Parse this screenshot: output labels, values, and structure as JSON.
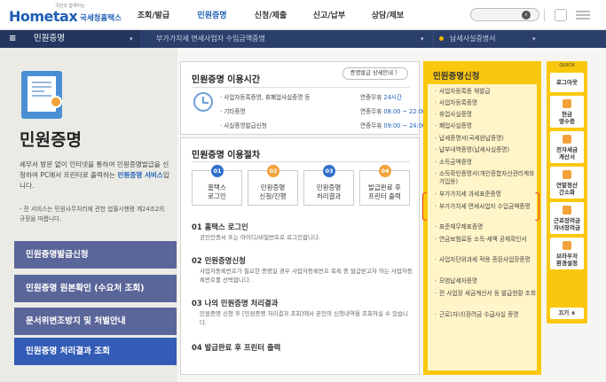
{
  "header": {
    "logo_main": "Hometax",
    "logo_sub": "국세청홈택스",
    "logo_tag": "국민과 함께하는",
    "menu": [
      "조회/발급",
      "민원증명",
      "신청/제출",
      "신고/납부",
      "상담/제보"
    ],
    "search_icon": "search-icon"
  },
  "navbar": {
    "home_icon": "≡",
    "section": "민원증명",
    "current": "부가가치세 면세사업자 수입금액증명",
    "sub": "납세사실증명서"
  },
  "left": {
    "title": "민원증명",
    "desc_prefix": "세무서 방문 없이 인터넷을 통하여 민원증명발급을 신청하여 PC에서 프린터로 출력하는 ",
    "desc_highlight": "민원증명 서비스",
    "desc_suffix": "입니다.",
    "note": "- 전 서비스는 민원사무처리에 관한 법률시행령 제24조2의 규정을 따릅니다.",
    "buttons": [
      "민원증명발급신청",
      "민원증명 원본확인 (수요처 조회)",
      "문서위변조방지 및 처벌안내",
      "민원증명 처리결과 조회"
    ]
  },
  "hours": {
    "title": "민원증명 이용시간",
    "more": "증명발급 상세안내 〉",
    "rows": [
      {
        "label": "· 사업자등록증명, 휴폐업사실증명 등",
        "value_prefix": "연중무휴 ",
        "value_hl": "24시간"
      },
      {
        "label": "· 기타증명",
        "value_prefix": "연중무휴 ",
        "value_hl": "08:00 ~ 22:00"
      },
      {
        "label": "· 사실증명발급신청",
        "value_prefix": "연중무휴 ",
        "value_hl": "09:00 ~ 24:00"
      }
    ]
  },
  "procedure": {
    "title": "민원증명 이용절차",
    "steps": [
      {
        "num": "01",
        "line1": "홈택스",
        "line2": "로그인",
        "color": "#2f6fc9"
      },
      {
        "num": "02",
        "line1": "민원증명",
        "line2": "신청/진행",
        "color": "#f2a23a"
      },
      {
        "num": "03",
        "line1": "민원증명",
        "line2": "처리결과",
        "color": "#2f6fc9"
      },
      {
        "num": "04",
        "line1": "발급완료 후",
        "line2": "프린터 출력",
        "color": "#f2a23a"
      }
    ],
    "sections": [
      {
        "head": "01 홈택스 로그인",
        "body": "공인인증서 또는 아이디/비밀번호로 로그인합니다."
      },
      {
        "head": "02 민원증명신청",
        "body": "사업자등록번호가 필요한 증명일 경우 사업자등록번호 목록 중 발급받고자 하는 사업자등록번호를 선택합니다."
      },
      {
        "head": "03 나의 민원증명 처리결과",
        "body": "민원증명 신청 후 [민원증명 처리결과 조회]에서 본인의 신청내역을 조회하실 수 있습니다."
      },
      {
        "head": "04 발급완료 후 프린터 출력",
        "body": ""
      }
    ]
  },
  "yellow": {
    "title": "민원증명신청",
    "items": [
      "사업자등록증 재발급",
      "사업자등록증명",
      "휴업사실증명",
      "폐업사실증명",
      "납세증명서(국세완납증명)",
      "납부내역증명(납세사실증명)",
      "소득금액증명",
      "소득확인증명서(개인종합자산관리계좌 가입용)",
      "부가가치세 과세표준증명",
      "부가가치세 면세사업자 수입금액증명",
      "표준재무제표증명",
      "연금보험료등 소득·세액 공제확인서",
      "사업자단위과세 적용 종된사업장증명",
      "모범납세자증명",
      "전 사업장 세금계산서 등 발급현황 조회",
      "근로(자녀)장려금 수급사실 증명"
    ]
  },
  "quick": {
    "head": "QUICK",
    "items": [
      "로그아웃",
      "현금\n영수증",
      "전자세금\n계산서",
      "연말정산\n간소화",
      "근로장려금\n자녀장려금",
      "브라우저\n환경설정"
    ],
    "close": "끄기 ∧"
  }
}
